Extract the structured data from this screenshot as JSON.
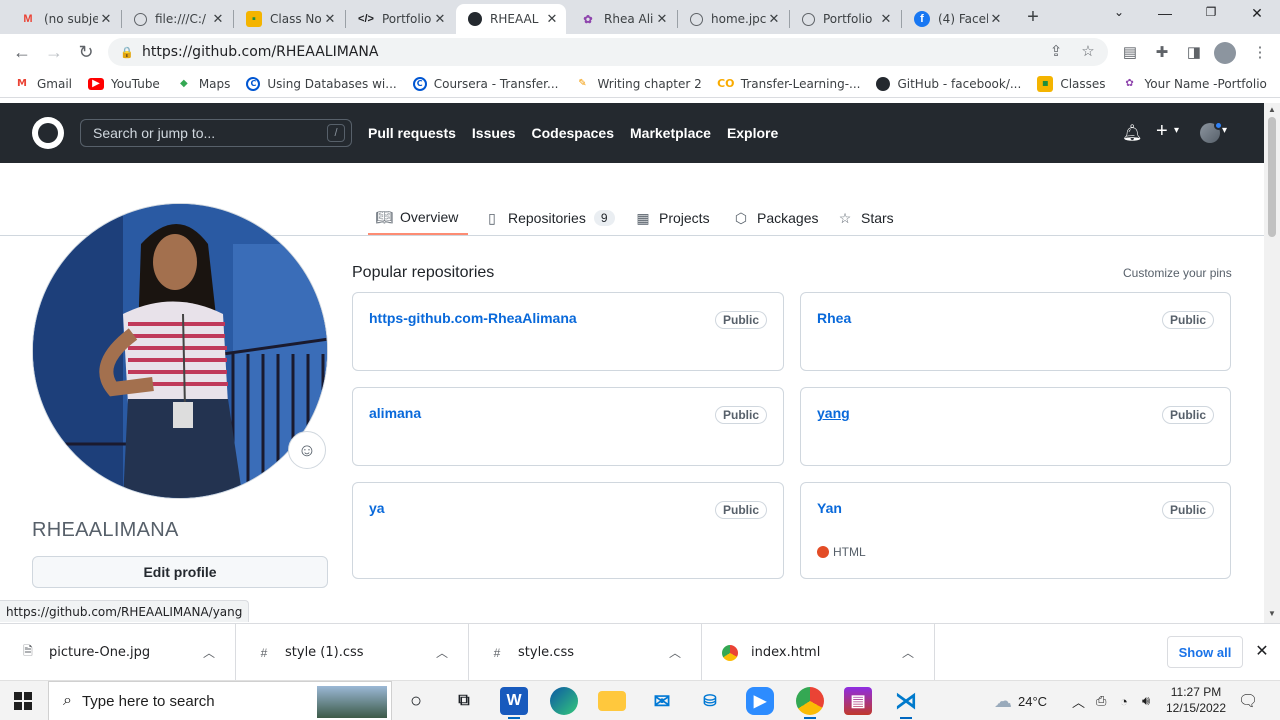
{
  "browser": {
    "tabs": [
      {
        "label": "(no subje",
        "icon": "gmail-icon"
      },
      {
        "label": "file:///C:/",
        "icon": "globe-icon"
      },
      {
        "label": "Class No",
        "icon": "classroom-icon"
      },
      {
        "label": "Portfolio",
        "icon": "code-icon"
      },
      {
        "label": "RHEAAL",
        "icon": "github-icon"
      },
      {
        "label": "Rhea Alir",
        "icon": "portfolio-icon"
      },
      {
        "label": "home.jpc",
        "icon": "globe-icon"
      },
      {
        "label": "Portfolio",
        "icon": "globe-icon"
      },
      {
        "label": "(4) Faceb",
        "icon": "facebook-icon"
      }
    ],
    "url": "https://github.com/RHEAALIMANA",
    "bookmarks": [
      {
        "label": "Gmail",
        "icon": "gmail-icon"
      },
      {
        "label": "YouTube",
        "icon": "youtube-icon"
      },
      {
        "label": "Maps",
        "icon": "maps-icon"
      },
      {
        "label": "Using Databases wi...",
        "icon": "coursera-icon"
      },
      {
        "label": "Coursera - Transfer...",
        "icon": "coursera-icon"
      },
      {
        "label": "Writing chapter 2",
        "icon": "writing-icon"
      },
      {
        "label": "Transfer-Learning-...",
        "icon": "colab-icon"
      },
      {
        "label": "GitHub - facebook/...",
        "icon": "github-icon"
      },
      {
        "label": "Classes",
        "icon": "classroom-icon"
      },
      {
        "label": "Your Name -Portfolio",
        "icon": "portfolio-icon"
      }
    ],
    "status_url": "https://github.com/RHEAALIMANA/yang"
  },
  "github": {
    "search_placeholder": "Search or jump to...",
    "search_shortcut": "/",
    "nav": [
      "Pull requests",
      "Issues",
      "Codespaces",
      "Marketplace",
      "Explore"
    ],
    "profile_tabs": [
      {
        "label": "Overview",
        "icon": "book-icon"
      },
      {
        "label": "Repositories",
        "icon": "repo-icon",
        "count": "9"
      },
      {
        "label": "Projects",
        "icon": "table-icon"
      },
      {
        "label": "Packages",
        "icon": "package-icon"
      },
      {
        "label": "Stars",
        "icon": "star-icon"
      }
    ],
    "username": "RHEAALIMANA",
    "edit_profile": "Edit profile",
    "popular_title": "Popular repositories",
    "customize_pins": "Customize your pins",
    "repos": [
      {
        "name": "https-github.com-RheaAlimana",
        "visibility": "Public",
        "language": ""
      },
      {
        "name": "Rhea",
        "visibility": "Public",
        "language": ""
      },
      {
        "name": "alimana",
        "visibility": "Public",
        "language": ""
      },
      {
        "name": "yang",
        "visibility": "Public",
        "language": ""
      },
      {
        "name": "ya",
        "visibility": "Public",
        "language": ""
      },
      {
        "name": "Yan",
        "visibility": "Public",
        "language": "HTML"
      }
    ],
    "language_color": "#e34c26"
  },
  "downloads": {
    "items": [
      {
        "name": "picture-One.jpg",
        "icon": "image-file-icon"
      },
      {
        "name": "style (1).css",
        "icon": "css-file-icon"
      },
      {
        "name": "style.css",
        "icon": "css-file-icon"
      },
      {
        "name": "index.html",
        "icon": "chrome-icon"
      }
    ],
    "show_all": "Show all"
  },
  "taskbar": {
    "search_placeholder": "Type here to search",
    "temperature": "24°C",
    "time": "11:27 PM",
    "date": "12/15/2022"
  }
}
